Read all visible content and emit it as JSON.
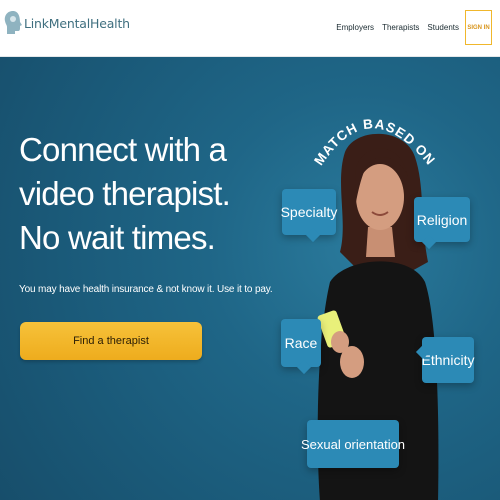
{
  "header": {
    "logo_text": "LinkMentalHealth",
    "nav": [
      "Employers",
      "Therapists",
      "Students"
    ],
    "signin_label": "SIGN IN"
  },
  "hero": {
    "title": "Connect with a video therapist. No wait times.",
    "subtitle": "You may have health insurance & not know it. Use it to pay.",
    "cta_label": "Find a therapist",
    "match_label": "MATCH BASED ON",
    "tags": {
      "specialty": "Specialty",
      "religion": "Religion",
      "race": "Race",
      "ethnicity": "Ethnicity",
      "sexual_orientation": "Sexual orientation"
    }
  },
  "colors": {
    "brand": "#3f6f7f",
    "accent": "#f0b72c",
    "hero_bg": "#1f6687",
    "chip_bg": "#2c8ab6"
  },
  "icons": [
    "head-logo-icon"
  ]
}
